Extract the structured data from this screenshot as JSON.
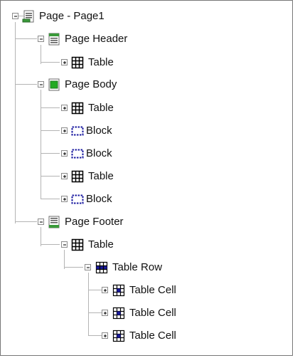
{
  "tree": {
    "page": {
      "label": "Page - Page1",
      "icon": "page-icon",
      "state": "expanded"
    },
    "header": {
      "label": "Page Header",
      "icon": "page-header-icon",
      "state": "expanded"
    },
    "header_table": {
      "label": "Table",
      "icon": "table-icon",
      "state": "collapsed"
    },
    "body": {
      "label": "Page Body",
      "icon": "page-body-icon",
      "state": "expanded"
    },
    "body_table1": {
      "label": "Table",
      "icon": "table-icon",
      "state": "collapsed"
    },
    "body_block1": {
      "label": "Block",
      "icon": "block-icon",
      "state": "collapsed"
    },
    "body_block2": {
      "label": "Block",
      "icon": "block-icon",
      "state": "collapsed"
    },
    "body_table2": {
      "label": "Table",
      "icon": "table-icon",
      "state": "collapsed"
    },
    "body_block3": {
      "label": "Block",
      "icon": "block-icon",
      "state": "collapsed"
    },
    "footer": {
      "label": "Page Footer",
      "icon": "page-footer-icon",
      "state": "expanded"
    },
    "footer_table": {
      "label": "Table",
      "icon": "table-icon",
      "state": "expanded"
    },
    "table_row": {
      "label": "Table Row",
      "icon": "table-row-icon",
      "state": "expanded"
    },
    "cell1": {
      "label": "Table Cell",
      "icon": "table-cell-icon",
      "state": "collapsed"
    },
    "cell2": {
      "label": "Table Cell",
      "icon": "table-cell-icon",
      "state": "collapsed"
    },
    "cell3": {
      "label": "Table Cell",
      "icon": "table-cell-icon",
      "state": "collapsed"
    }
  }
}
